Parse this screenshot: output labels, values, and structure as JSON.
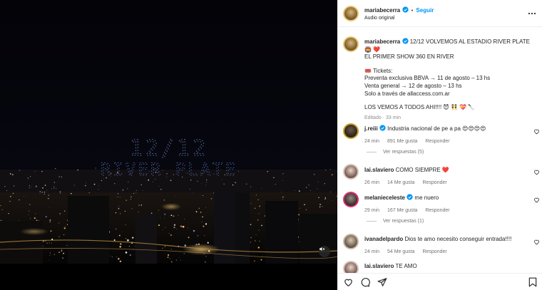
{
  "post": {
    "username": "mariabecerra",
    "follow_label": "Seguir",
    "separator": "•",
    "audio": "Audio original",
    "caption_lines": [
      "12/12 VOLVEMOS AL ESTADIO RIVER PLATE 🏟️ ❤️",
      "EL PRIMER SHOW 360 EN RIVER",
      "",
      "🎟️ Tickets:",
      "Preventa exclusiva BBVA → 11 de agosto – 13 hs",
      "Venta general → 12 de agosto – 13 hs",
      "Solo a través de allaccess.com.ar",
      "",
      "LOS VEMOS A TODOS AHI!!!! 😈 👯 💝 🔪"
    ],
    "edited": "Editado · 33 min"
  },
  "media": {
    "drone_text_line1": "12/12",
    "drone_text_line2": "RIVER PLATE"
  },
  "comments": [
    {
      "user": "j.reiii",
      "verified": true,
      "text": "Industria nacional de pe a pa 😍😍😍😍",
      "time": "24 min",
      "likes": "891 Me gusta",
      "reply": "Responder",
      "view_replies": "Ver respuestas (5)"
    },
    {
      "user": "lai.slaviero",
      "verified": false,
      "text": "COMO SIEMPRE ❤️",
      "time": "26 min",
      "likes": "14 Me gusta",
      "reply": "Responder",
      "view_replies": ""
    },
    {
      "user": "melanieceleste",
      "verified": true,
      "text": "me nuero",
      "time": "29 min",
      "likes": "167 Me gusta",
      "reply": "Responder",
      "view_replies": "Ver respuestas (1)"
    },
    {
      "user": "ivanadelpardo",
      "verified": false,
      "text": "Dios te amo necesito conseguir entrada!!!!",
      "time": "24 min",
      "likes": "54 Me gusta",
      "reply": "Responder",
      "view_replies": ""
    },
    {
      "user": "lai.slaviero",
      "verified": false,
      "text": "TE AMO",
      "time": "",
      "likes": "",
      "reply": "",
      "view_replies": ""
    }
  ],
  "icons": {
    "like": "heart-icon",
    "comment": "comment-icon",
    "share": "share-icon",
    "save": "bookmark-icon",
    "more": "more-icon",
    "mute": "speaker-muted-icon"
  },
  "colors": {
    "accent": "#0095f6",
    "verified": "#0095f6",
    "meta_text": "#737373"
  }
}
